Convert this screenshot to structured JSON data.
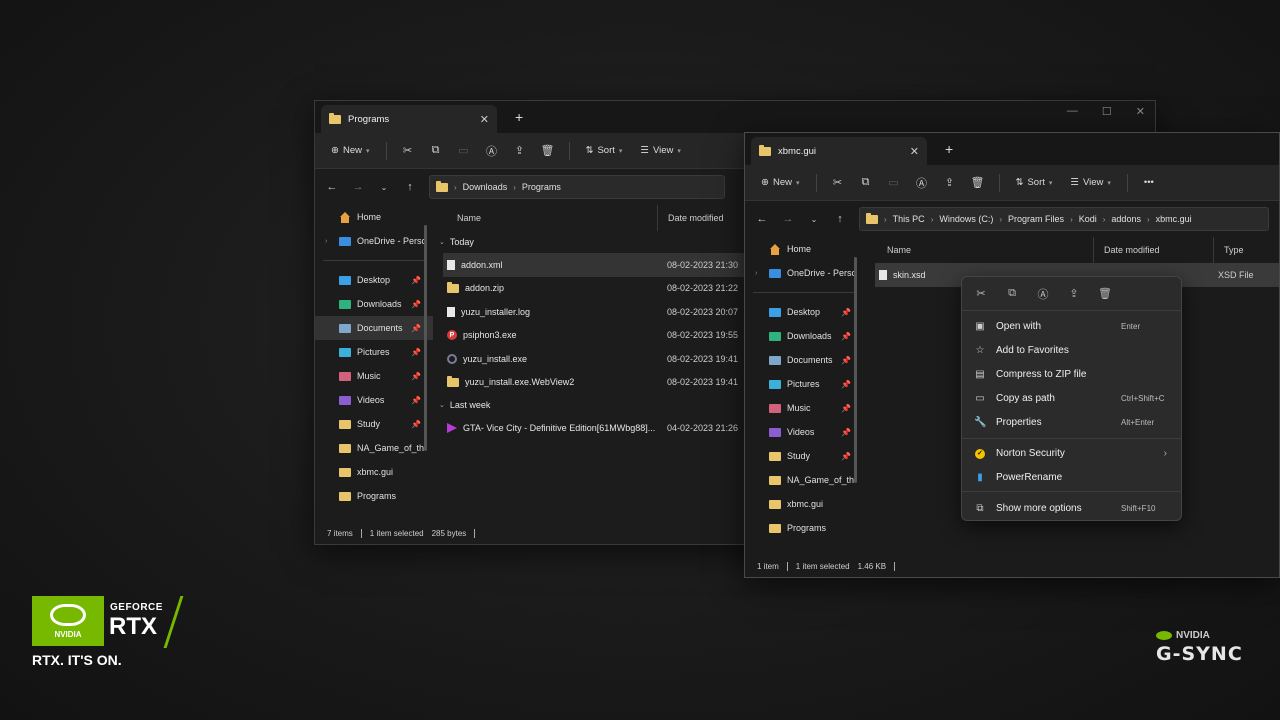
{
  "window1": {
    "tab_title": "Programs",
    "toolbar": {
      "new_label": "New",
      "sort_label": "Sort",
      "view_label": "View"
    },
    "breadcrumb": [
      "Downloads",
      "Programs"
    ],
    "sidebar": {
      "top": [
        {
          "label": "Home"
        },
        {
          "label": "OneDrive - Perso"
        }
      ],
      "pinned": [
        {
          "label": "Desktop",
          "color": "#3aa0e8",
          "pinned": true
        },
        {
          "label": "Downloads",
          "color": "#2fb37e",
          "pinned": true
        },
        {
          "label": "Documents",
          "color": "#7fa7c9",
          "pinned": true,
          "selected": true
        },
        {
          "label": "Pictures",
          "color": "#3bb0d8",
          "pinned": true
        },
        {
          "label": "Music",
          "color": "#d2617b",
          "pinned": true
        },
        {
          "label": "Videos",
          "color": "#8a5ed0",
          "pinned": true
        },
        {
          "label": "Study",
          "color": "#e8c46a",
          "pinned": true
        },
        {
          "label": "NA_Game_of_th",
          "color": "#e8c46a",
          "pinned": false
        },
        {
          "label": "xbmc.gui",
          "color": "#e8c46a",
          "pinned": false
        },
        {
          "label": "Programs",
          "color": "#e8c46a",
          "pinned": false
        }
      ]
    },
    "columns": {
      "name": "Name",
      "date": "Date modified"
    },
    "groups": [
      {
        "label": "Today",
        "files": [
          {
            "name": "addon.xml",
            "date": "08-02-2023 21:30",
            "icon": "file-icon",
            "selected": true
          },
          {
            "name": "addon.zip",
            "date": "08-02-2023 21:22",
            "icon": "zip-folder-icon"
          },
          {
            "name": "yuzu_installer.log",
            "date": "08-02-2023 20:07",
            "icon": "file-icon"
          },
          {
            "name": "psiphon3.exe",
            "date": "08-02-2023 19:55",
            "icon": "psiphon-icon"
          },
          {
            "name": "yuzu_install.exe",
            "date": "08-02-2023 19:41",
            "icon": "yuzu-icon"
          },
          {
            "name": "yuzu_install.exe.WebView2",
            "date": "08-02-2023 19:41",
            "icon": "folder-icon"
          }
        ]
      },
      {
        "label": "Last week",
        "files": [
          {
            "name": "GTA- Vice City - Definitive Edition[61MWbg88]...",
            "date": "04-02-2023 21:26",
            "icon": "torrent-icon"
          }
        ]
      }
    ],
    "status": {
      "count": "7 items",
      "selection": "1 item selected",
      "size": "285 bytes"
    }
  },
  "window2": {
    "tab_title": "xbmc.gui",
    "toolbar": {
      "new_label": "New",
      "sort_label": "Sort",
      "view_label": "View",
      "more_label": "•••"
    },
    "breadcrumb": [
      "This PC",
      "Windows (C:)",
      "Program Files",
      "Kodi",
      "addons",
      "xbmc.gui"
    ],
    "sidebar": {
      "top": [
        {
          "label": "Home"
        },
        {
          "label": "OneDrive - Perso"
        }
      ],
      "pinned": [
        {
          "label": "Desktop",
          "color": "#3aa0e8",
          "pinned": true
        },
        {
          "label": "Downloads",
          "color": "#2fb37e",
          "pinned": true
        },
        {
          "label": "Documents",
          "color": "#7fa7c9",
          "pinned": true
        },
        {
          "label": "Pictures",
          "color": "#3bb0d8",
          "pinned": true
        },
        {
          "label": "Music",
          "color": "#d2617b",
          "pinned": true
        },
        {
          "label": "Videos",
          "color": "#8a5ed0",
          "pinned": true
        },
        {
          "label": "Study",
          "color": "#e8c46a",
          "pinned": true
        },
        {
          "label": "NA_Game_of_th",
          "color": "#e8c46a",
          "pinned": false
        },
        {
          "label": "xbmc.gui",
          "color": "#e8c46a",
          "pinned": false
        },
        {
          "label": "Programs",
          "color": "#e8c46a",
          "pinned": false
        }
      ]
    },
    "columns": {
      "name": "Name",
      "date": "Date modified",
      "type": "Type"
    },
    "file": {
      "name": "skin.xsd",
      "type": "XSD File"
    },
    "status": {
      "count": "1 item",
      "selection": "1 item selected",
      "size": "1.46 KB"
    }
  },
  "context_menu": {
    "items": [
      {
        "label": "Open with",
        "shortcut": "Enter",
        "icon": "open-with-icon"
      },
      {
        "label": "Add to Favorites",
        "shortcut": "",
        "icon": "star-icon"
      },
      {
        "label": "Compress to ZIP file",
        "shortcut": "",
        "icon": "zip-icon"
      },
      {
        "label": "Copy as path",
        "shortcut": "Ctrl+Shift+C",
        "icon": "copy-path-icon"
      },
      {
        "label": "Properties",
        "shortcut": "Alt+Enter",
        "icon": "properties-icon"
      }
    ],
    "extra": [
      {
        "label": "Norton Security",
        "has_submenu": true,
        "icon": "norton-icon"
      },
      {
        "label": "PowerRename",
        "icon": "powerrename-icon"
      }
    ],
    "more": {
      "label": "Show more options",
      "shortcut": "Shift+F10"
    }
  },
  "branding": {
    "nvidia_label": "NVIDIA",
    "geforce_label": "GEFORCE",
    "rtx_label": "RTX",
    "tagline": "RTX. IT'S ON.",
    "gsync_brand": "NVIDIA",
    "gsync_label": "G-SYNC",
    "accent": "#76b900"
  }
}
